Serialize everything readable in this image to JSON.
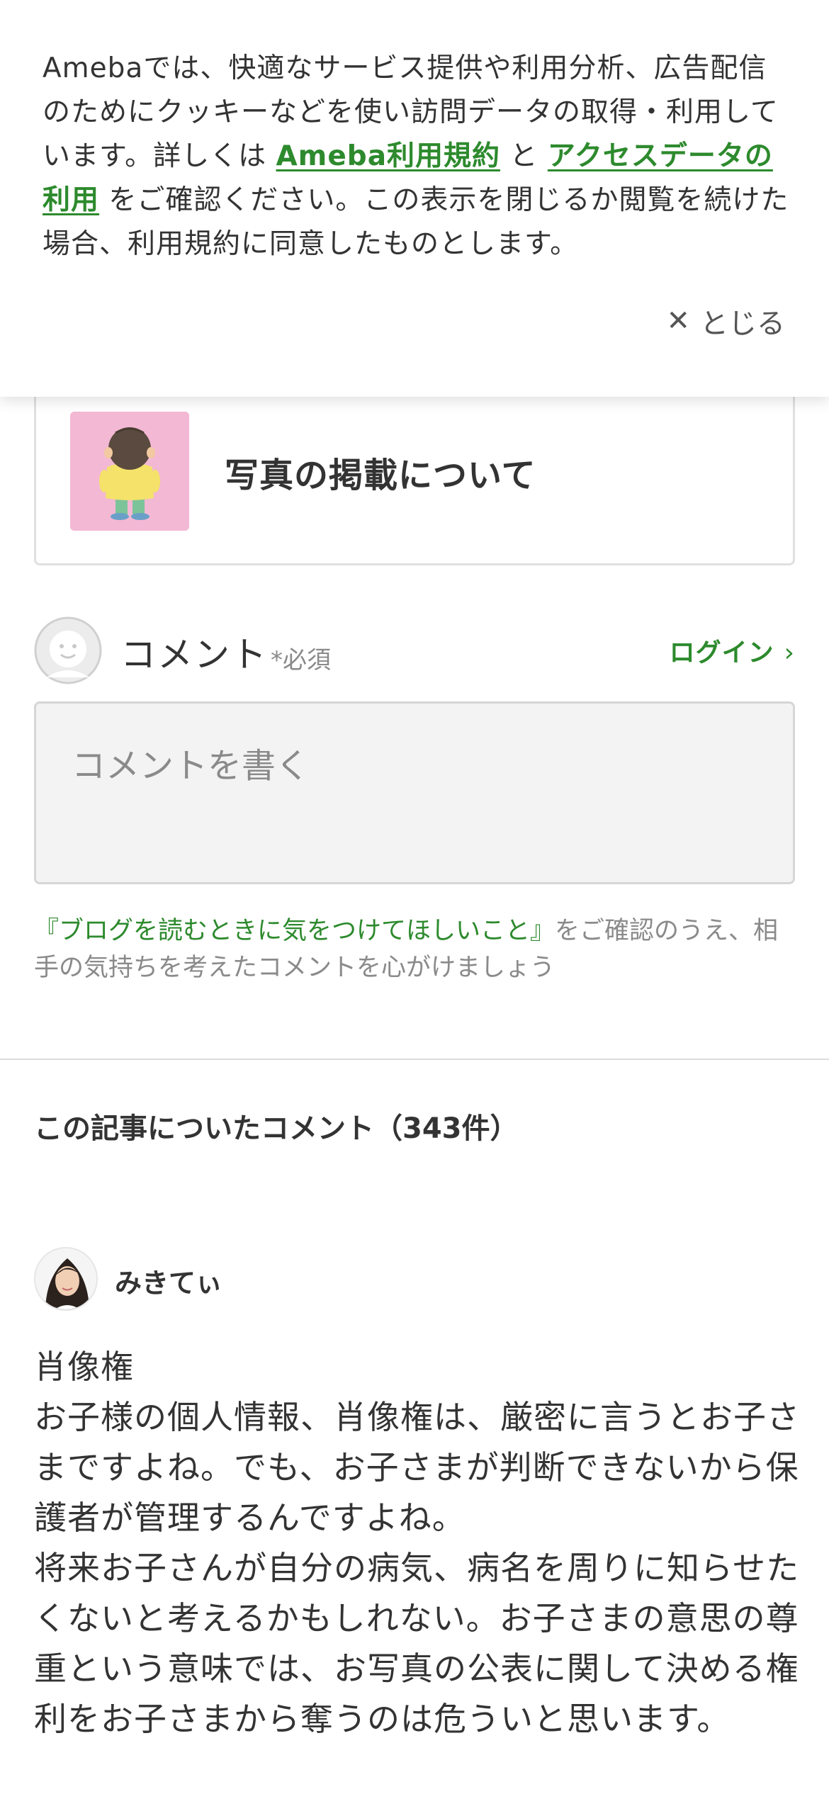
{
  "cookie_banner": {
    "text_1": "Amebaでは、快適なサービス提供や利用分析、広告配信のためにクッキーなどを使い訪問データの取得・利用しています。詳しくは ",
    "link_terms": "Ameba利用規約",
    "text_2": " と ",
    "link_access_data": "アクセスデータの利用",
    "text_3": " をご確認ください。この表示を閉じるか閲覧を続けた場合、利用規約に同意したものとします。",
    "close_label": "とじる",
    "close_icon": "close-icon"
  },
  "related_article": {
    "title": "写真の掲載について",
    "thumbnail_icon": "child-illustration"
  },
  "comment_form": {
    "label": "コメント",
    "required": "*必須",
    "login_label": "ログイン",
    "placeholder": "コメントを書く",
    "guideline_link": "『ブログを読むときに気をつけてほしいこと』",
    "guideline_text": "をご確認のうえ、相手の気持ちを考えたコメントを心がけましょう"
  },
  "comments": {
    "header": "この記事についたコメント（343件）",
    "items": [
      {
        "author": "みきてぃ",
        "lines": [
          "肖像権",
          "お子様の個人情報、肖像権は、厳密に言うとお子さまですよね。でも、お子さまが判断できないから保護者が管理するんですよね。",
          "将来お子さんが自分の病気、病名を周りに知らせたくないと考えるかもしれない。お子さまの意思の尊重という意味では、お写真の公表に関して決める権利をお子さまから奪うのは危ういと思います。"
        ]
      }
    ]
  },
  "colors": {
    "accent_green": "#2d8a2d",
    "text": "#333333",
    "muted": "#8a8a8a",
    "thumb_bg": "#f3b8d4"
  }
}
